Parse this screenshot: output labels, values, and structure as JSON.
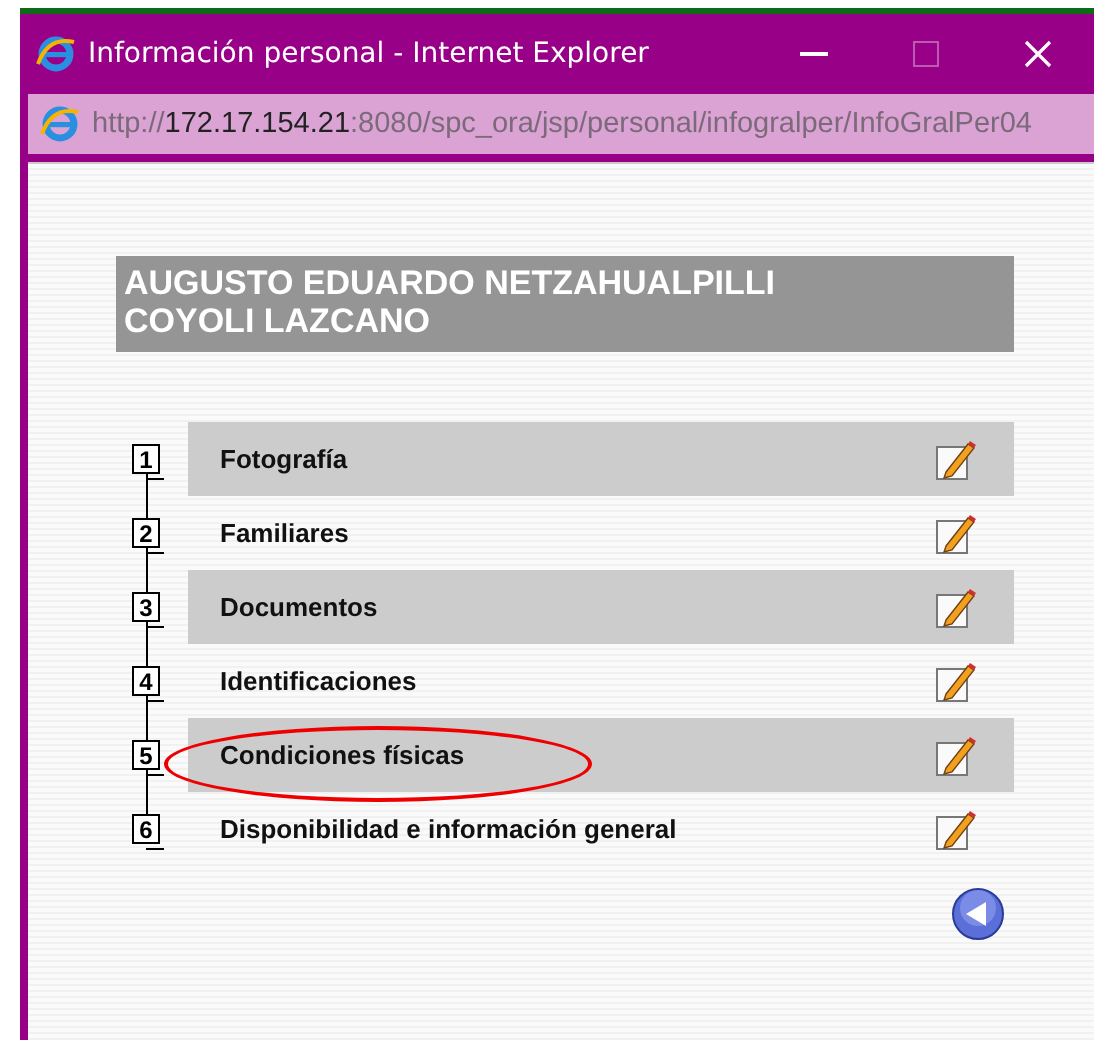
{
  "window": {
    "title": "Información personal - Internet Explorer",
    "maximize_disabled": true
  },
  "address_bar": {
    "scheme": "http://",
    "host": "172.17.154.21",
    "path": ":8080/spc_ora/jsp/personal/infogralper/InfoGralPer04"
  },
  "person_name": "AUGUSTO EDUARDO NETZAHUALPILLI COYOLI LAZCANO",
  "sections": [
    {
      "number": "1",
      "label": "Fotografía",
      "circled": false
    },
    {
      "number": "2",
      "label": "Familiares",
      "circled": false
    },
    {
      "number": "3",
      "label": "Documentos",
      "circled": false
    },
    {
      "number": "4",
      "label": "Identificaciones",
      "circled": false
    },
    {
      "number": "5",
      "label": "Condiciones físicas",
      "circled": true
    },
    {
      "number": "6",
      "label": "Disponibilidad e información general",
      "circled": false
    }
  ]
}
